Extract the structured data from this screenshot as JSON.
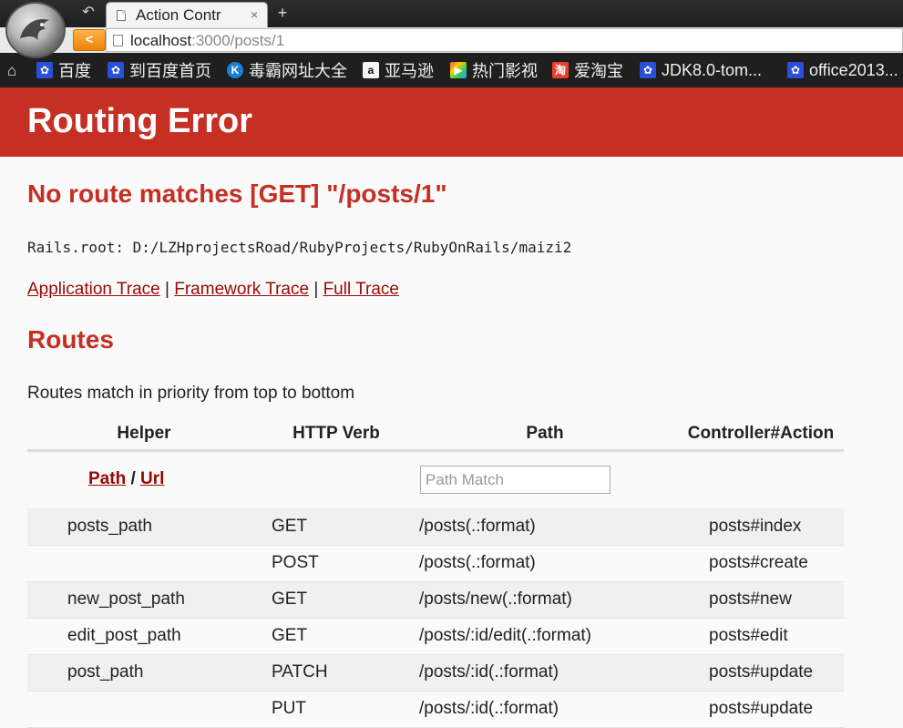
{
  "browser": {
    "tab_title": "Action Contr",
    "tab_close": "×",
    "new_tab": "+",
    "url_host": "localhost",
    "url_rest": ":3000/posts/1",
    "bookmarks": [
      {
        "label": "百度",
        "icon": "paw-icon"
      },
      {
        "label": "到百度首页",
        "icon": "paw-icon"
      },
      {
        "label": "毒霸网址大全",
        "icon": "kingsoft-icon"
      },
      {
        "label": "亚马逊",
        "icon": "amazon-icon"
      },
      {
        "label": "热门影视",
        "icon": "play-icon"
      },
      {
        "label": "爱淘宝",
        "icon": "taobao-icon"
      },
      {
        "label": "JDK8.0-tom...",
        "icon": "paw-icon"
      },
      {
        "label": "office2013...",
        "icon": "paw-icon"
      }
    ]
  },
  "page": {
    "title": "Routing Error",
    "error_message": "No route matches [GET] \"/posts/1\"",
    "rails_root": "Rails.root: D:/LZHprojectsRoad/RubyProjects/RubyOnRails/maizi2",
    "trace_links": {
      "application": "Application Trace",
      "framework": "Framework Trace",
      "full": "Full Trace",
      "separator": "|"
    },
    "routes_heading": "Routes",
    "routes_note": "Routes match in priority from top to bottom"
  },
  "routes_table": {
    "headers": [
      "Helper",
      "HTTP Verb",
      "Path",
      "Controller#Action"
    ],
    "toggle": {
      "path": "Path",
      "separator": "/",
      "url": "Url"
    },
    "search_placeholder": "Path Match",
    "rows": [
      {
        "helper": "posts_path",
        "verb": "GET",
        "path": "/posts(.:format)",
        "action": "posts#index"
      },
      {
        "helper": "",
        "verb": "POST",
        "path": "/posts(.:format)",
        "action": "posts#create"
      },
      {
        "helper": "new_post_path",
        "verb": "GET",
        "path": "/posts/new(.:format)",
        "action": "posts#new"
      },
      {
        "helper": "edit_post_path",
        "verb": "GET",
        "path": "/posts/:id/edit(.:format)",
        "action": "posts#edit"
      },
      {
        "helper": "post_path",
        "verb": "PATCH",
        "path": "/posts/:id(.:format)",
        "action": "posts#update"
      },
      {
        "helper": "",
        "verb": "PUT",
        "path": "/posts/:id(.:format)",
        "action": "posts#update"
      }
    ]
  }
}
